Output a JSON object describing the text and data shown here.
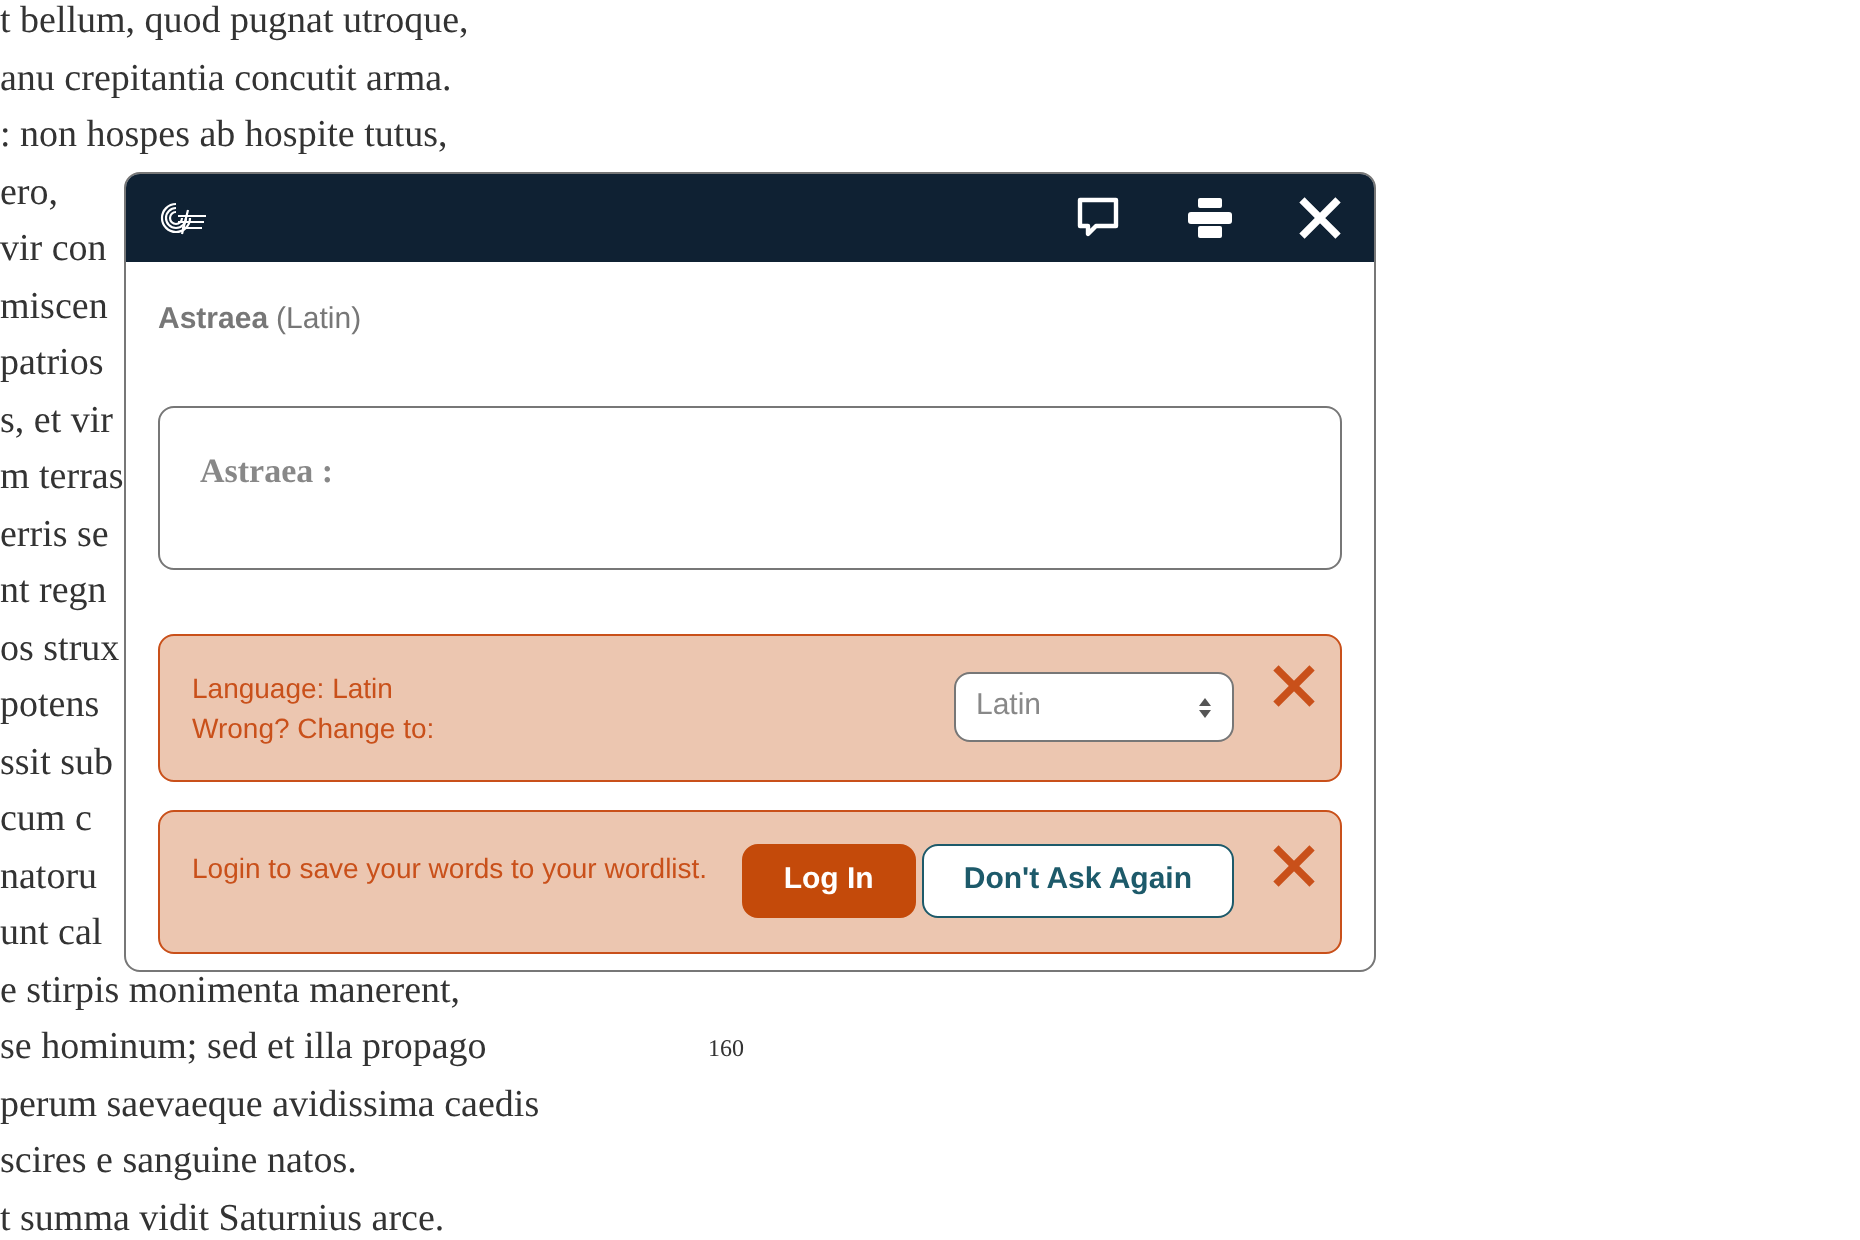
{
  "background_text": {
    "lines": [
      {
        "text": "t bellum, quod pugnat utroque,"
      },
      {
        "text": "anu crepitantia concutit arma."
      },
      {
        "text": ": non hospes ab hospite tutus,"
      },
      {
        "text": "ero,"
      },
      {
        "text": "vir con"
      },
      {
        "text": "miscen"
      },
      {
        "text": "patrios"
      },
      {
        "text": "s, et vir"
      },
      {
        "text": "m terras"
      },
      {
        "text": "erris se"
      },
      {
        "text": "nt regn"
      },
      {
        "text": "os strux"
      },
      {
        "text": "potens"
      },
      {
        "text": "ssit sub"
      },
      {
        "text": "cum c"
      },
      {
        "text": "natoru"
      },
      {
        "text": "unt cal"
      },
      {
        "text": "e stirpis monimenta manerent,"
      },
      {
        "text": "se hominum; sed et illa propago",
        "line_number": "160"
      },
      {
        "text": "perum saevaeque avidissima caedis"
      },
      {
        "text": "scires e sanguine natos."
      },
      {
        "text": "t summa vidit Saturnius arce."
      }
    ]
  },
  "popup": {
    "word": "Astraea",
    "language": "(Latin)",
    "definition": {
      "headword": "Astraea :"
    },
    "language_notice": {
      "lines": [
        "Language: Latin",
        "Wrong? Change to:"
      ],
      "select_value": "Latin"
    },
    "login_notice": {
      "message": "Login to save your words to your wordlist.",
      "buttons": [
        {
          "label": "Log In",
          "kind": "primary"
        },
        {
          "label": "Don't Ask Again",
          "kind": "secondary"
        }
      ]
    }
  }
}
